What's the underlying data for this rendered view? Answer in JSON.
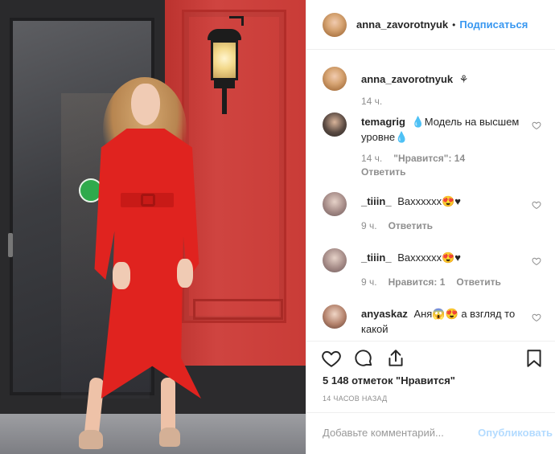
{
  "post": {
    "author": "anna_zavorotnyuk",
    "header_dot": "•",
    "follow_label": "Подписаться",
    "caption": {
      "user": "anna_zavorotnyuk",
      "text": "⚘",
      "time": "14 ч."
    }
  },
  "comments": [
    {
      "user": "temagrig",
      "text": "💧Модель на высшем уровне💧",
      "time": "14 ч.",
      "likes": "\"Нравится\": 14",
      "reply": "Ответить"
    },
    {
      "user": "_tiiin_",
      "text": "Вахххххх😍♥",
      "time": "9 ч.",
      "likes": "",
      "reply": "Ответить"
    },
    {
      "user": "_tiiin_",
      "text": "Вахххххх😍♥",
      "time": "9 ч.",
      "likes": "Нравится: 1",
      "reply": "Ответить"
    },
    {
      "user": "anyaskaz",
      "text": "Аня😱😍 а взгляд то какой",
      "time": "",
      "likes": "",
      "reply": ""
    }
  ],
  "actions": {
    "like_icon": "heart-icon",
    "comment_icon": "comment-bubble-icon",
    "share_icon": "share-upload-icon",
    "save_icon": "bookmark-icon",
    "likes_count": "5 148 отметок \"Нравится\"",
    "timestamp": "14 часов назад"
  },
  "comment_box": {
    "placeholder": "Добавьте комментарий...",
    "publish_label": "Опубликовать"
  },
  "colors": {
    "accent": "#3897f0",
    "publish_disabled": "#b3dbff",
    "muted": "#8e8e8e",
    "text": "#262626",
    "dress_red": "#e0231f"
  }
}
